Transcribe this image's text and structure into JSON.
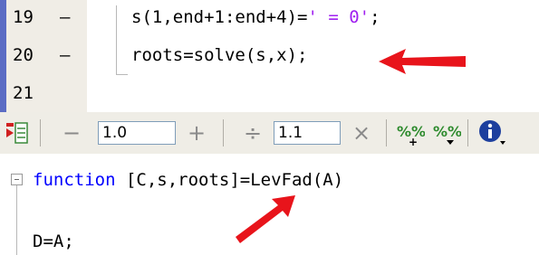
{
  "editor_top": {
    "lines": [
      {
        "number": "19",
        "marker": "–",
        "code_prefix": "s(1,end+1:end+4)=",
        "code_string": "' = 0'",
        "code_suffix": ";"
      },
      {
        "number": "20",
        "marker": "–",
        "code_prefix": "roots=solve(s,x);",
        "code_string": "",
        "code_suffix": ""
      },
      {
        "number": "21",
        "marker": "",
        "code_prefix": "",
        "code_string": "",
        "code_suffix": ""
      }
    ]
  },
  "toolbar": {
    "cell_icon": "insert-cell-icon",
    "minus_label": "−",
    "value1": "1.0",
    "plus_label": "+",
    "divide_label": "÷",
    "value2": "1.1",
    "times_label": "×",
    "percent_plus_icon": "cell-percent-increase-icon",
    "percent_minus_icon": "cell-percent-decrease-icon",
    "info_icon": "info-icon"
  },
  "editor_bottom": {
    "line1_keyword": "function",
    "line1_rest": " [C,s,roots]=LevFad(A)",
    "line2": "D=A;"
  },
  "colors": {
    "keyword": "#0000ff",
    "string": "#a020f0",
    "arrow": "#e8141b",
    "gutter": "#f0ede6",
    "gutter_accent": "#5b6cc4"
  }
}
